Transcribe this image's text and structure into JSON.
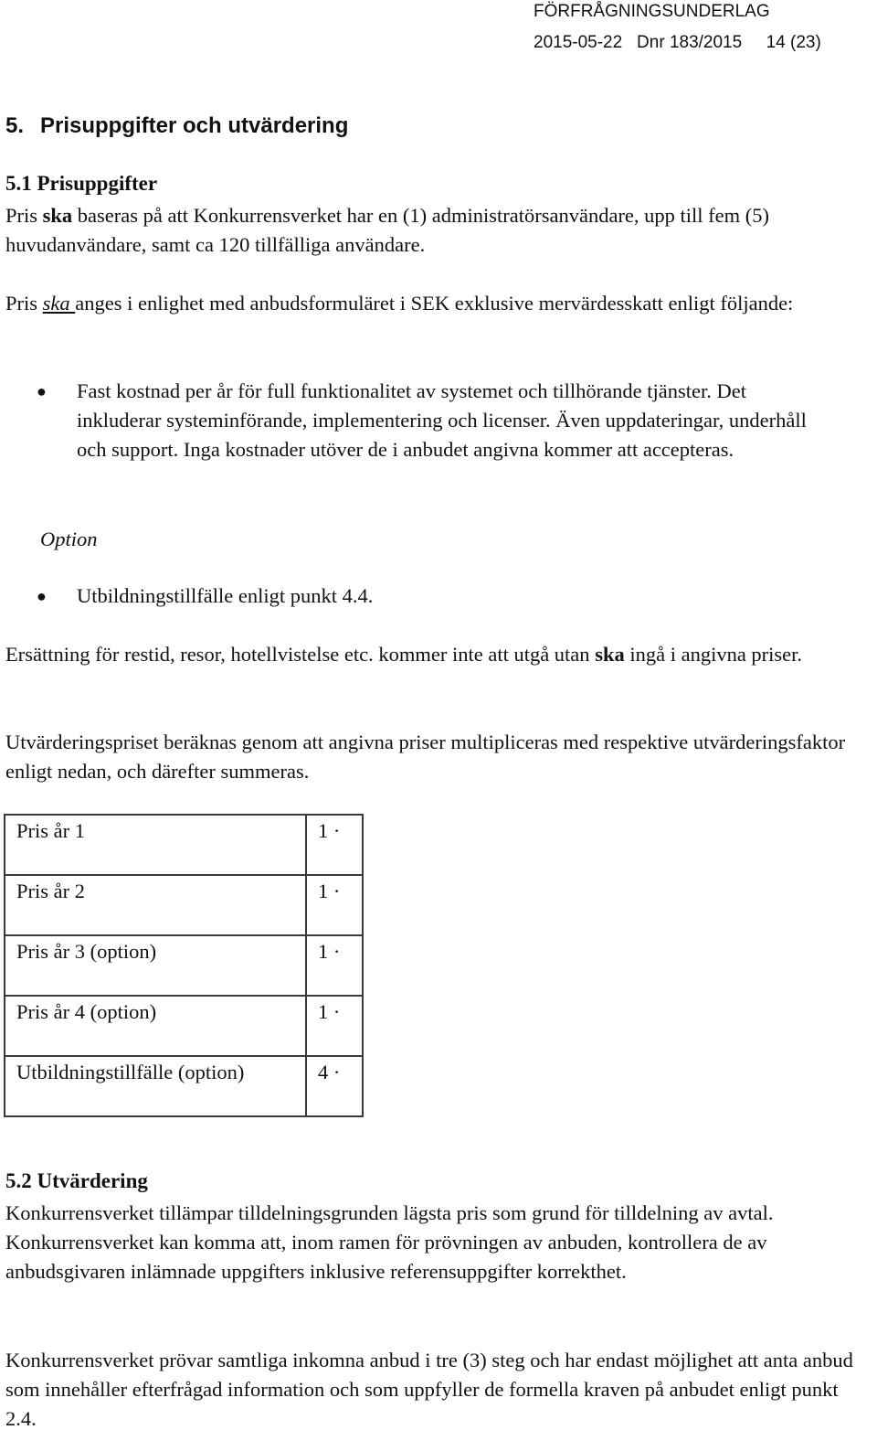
{
  "header": {
    "doc_type": "FÖRFRÅGNINGSUNDERLAG",
    "date": "2015-05-22",
    "dnr": "Dnr 183/2015",
    "page": "14 (23)"
  },
  "section": {
    "number": "5.",
    "title": "Prisuppgifter och utvärdering"
  },
  "sub1": {
    "heading": "5.1 Prisuppgifter",
    "para1_pre": "Pris ",
    "para1_bold": "ska",
    "para1_post": " baseras på att Konkurrensverket har en (1) administratörsanvändare, upp till fem (5) huvudanvändare, samt ca 120 tillfälliga användare.",
    "para2_pre": "Pris ",
    "para2_em": "ska ",
    "para2_post": "anges i enlighet med anbudsformuläret i SEK exklusive mervärdesskatt enligt följande:",
    "bullet1": "Fast kostnad per år för full funktionalitet av systemet och tillhörande tjänster. Det inkluderar systeminförande, implementering och licenser. Även uppdateringar, underhåll och support. Inga kostnader utöver de i anbudet angivna kommer att accepteras.",
    "option_label": "Option",
    "bullet2": "Utbildningstillfälle enligt punkt 4.4.",
    "para3_pre": "Ersättning för restid, resor, hotellvistelse etc. kommer inte att utgå utan ",
    "para3_bold": "ska",
    "para3_post": " ingå i angivna priser.",
    "para4": "Utvärderingspriset beräknas genom att angivna priser multipliceras med respektive utvärderingsfaktor enligt nedan, och därefter summeras."
  },
  "factor_table": {
    "rows": [
      {
        "label": "Pris år 1",
        "factor": "1 ·"
      },
      {
        "label": "Pris år 2",
        "factor": "1 ·"
      },
      {
        "label": "Pris år 3 (option)",
        "factor": "1 ·"
      },
      {
        "label": "Pris år 4 (option)",
        "factor": "1 ·"
      },
      {
        "label": "Utbildningstillfälle (option)",
        "factor": "4 ·"
      }
    ]
  },
  "sub2": {
    "heading": "5.2 Utvärdering",
    "para1": "Konkurrensverket tillämpar tilldelningsgrunden lägsta pris som grund för tilldelning av avtal. Konkurrensverket kan komma att, inom ramen för prövningen av anbuden, kontrollera de av anbudsgivaren inlämnade uppgifters inklusive referensuppgifter korrekthet.",
    "para2": "Konkurrensverket prövar samtliga inkomna anbud i tre (3) steg och har endast möjlighet att anta anbud som innehåller efterfrågad information och som uppfyller de formella kraven på anbudet enligt punkt 2.4."
  }
}
